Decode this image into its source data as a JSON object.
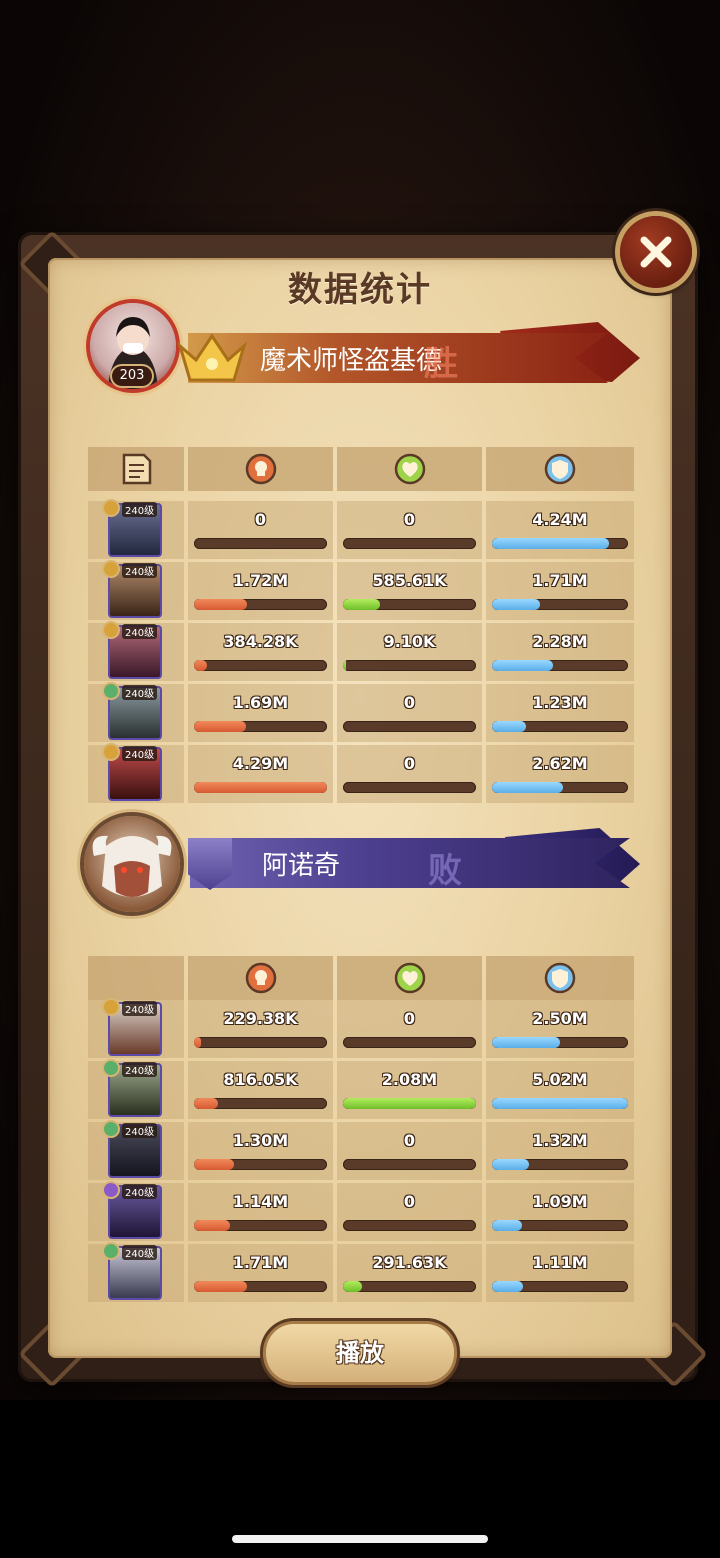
{
  "title": "数据统计",
  "close_icon": "close-icon",
  "play_label": "播放",
  "player_win": {
    "name": "魔术师怪盗基德",
    "level": "203",
    "result": "胜",
    "banner_color": "#b3562a"
  },
  "player_lose": {
    "name": "阿诺奇",
    "result": "败",
    "banner_color": "#4d3f8f"
  },
  "header_icons": [
    "scroll-icon",
    "damage-icon",
    "heal-icon",
    "defense-icon"
  ],
  "colors": {
    "damage": "#d65a32",
    "heal": "#6fbf2a",
    "defense": "#5aaee8"
  },
  "team_win": [
    {
      "level": "240级",
      "damage": "0",
      "heal": "0",
      "tank": "4.24M",
      "damage_pct": 0,
      "heal_pct": 0,
      "tank_pct": 86
    },
    {
      "level": "240级",
      "damage": "1.72M",
      "heal": "585.61K",
      "tank": "1.71M",
      "damage_pct": 40,
      "heal_pct": 28,
      "tank_pct": 35
    },
    {
      "level": "240级",
      "damage": "384.28K",
      "heal": "9.10K",
      "tank": "2.28M",
      "damage_pct": 10,
      "heal_pct": 2,
      "tank_pct": 45
    },
    {
      "level": "240级",
      "damage": "1.69M",
      "heal": "0",
      "tank": "1.23M",
      "damage_pct": 39,
      "heal_pct": 0,
      "tank_pct": 25
    },
    {
      "level": "240级",
      "damage": "4.29M",
      "heal": "0",
      "tank": "2.62M",
      "damage_pct": 100,
      "heal_pct": 0,
      "tank_pct": 52
    }
  ],
  "team_lose": [
    {
      "level": "240级",
      "damage": "229.38K",
      "heal": "0",
      "tank": "2.50M",
      "damage_pct": 5,
      "heal_pct": 0,
      "tank_pct": 50
    },
    {
      "level": "240级",
      "damage": "816.05K",
      "heal": "2.08M",
      "tank": "5.02M",
      "damage_pct": 18,
      "heal_pct": 100,
      "tank_pct": 100
    },
    {
      "level": "240级",
      "damage": "1.30M",
      "heal": "0",
      "tank": "1.32M",
      "damage_pct": 30,
      "heal_pct": 0,
      "tank_pct": 27
    },
    {
      "level": "240级",
      "damage": "1.14M",
      "heal": "0",
      "tank": "1.09M",
      "damage_pct": 27,
      "heal_pct": 0,
      "tank_pct": 22
    },
    {
      "level": "240级",
      "damage": "1.71M",
      "heal": "291.63K",
      "tank": "1.11M",
      "damage_pct": 40,
      "heal_pct": 14,
      "tank_pct": 23
    }
  ]
}
